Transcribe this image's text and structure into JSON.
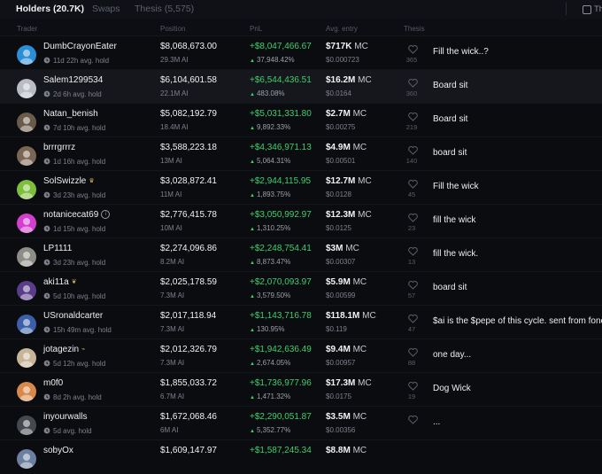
{
  "tabs": [
    {
      "label": "Holders (20.7K)"
    },
    {
      "label": "Swaps"
    },
    {
      "label": "Thesis (5,575)"
    }
  ],
  "filter_label": "Th",
  "columns": {
    "trader": "Trader",
    "position": "Position",
    "pnl": "PnL",
    "entry": "Avg. entry",
    "thesis": "Thesis"
  },
  "rows": [
    {
      "name": "DumbCrayonEater",
      "badge": "",
      "hold": "11d 22h avg. hold",
      "position": "$8,068,673.00",
      "amount": "29.3M AI",
      "pnl": "+$8,047,466.67",
      "pct": "37,948.42%",
      "mc": "$717K",
      "mc_unit": "MC",
      "entry": "$0.000723",
      "likes": "365",
      "thesis": "Fill the wick..?",
      "avatar_color": "#2c8ed6",
      "avatar_icon": "glasses-avatar"
    },
    {
      "name": "Salem1299534",
      "badge": "",
      "hold": "2d 6h avg. hold",
      "position": "$6,104,601.58",
      "amount": "22.1M AI",
      "pnl": "+$6,544,436.51",
      "pct": "483.08%",
      "mc": "$16.2M",
      "mc_unit": "MC",
      "entry": "$0.0164",
      "likes": "360",
      "thesis": "Board sit",
      "avatar_color": "#b9bcc4",
      "avatar_icon": "default-user-avatar"
    },
    {
      "name": "Natan_benish",
      "badge": "",
      "hold": "7d 10h avg. hold",
      "position": "$5,082,192.79",
      "amount": "18.4M AI",
      "pnl": "+$5,031,331.80",
      "pct": "9,892.33%",
      "mc": "$2.7M",
      "mc_unit": "MC",
      "entry": "$0.00275",
      "likes": "219",
      "thesis": "Board sit",
      "avatar_color": "#6a5a4a",
      "avatar_icon": "photo-avatar"
    },
    {
      "name": "brrrgrrrz",
      "badge": "",
      "hold": "1d 16h avg. hold",
      "position": "$3,588,223.18",
      "amount": "13M AI",
      "pnl": "+$4,346,971.13",
      "pct": "5,064.31%",
      "mc": "$4.9M",
      "mc_unit": "MC",
      "entry": "$0.00501",
      "likes": "140",
      "thesis": "board sit",
      "avatar_color": "#7a6652",
      "avatar_icon": "photo-avatar"
    },
    {
      "name": "SolSwizzle",
      "badge": "crown",
      "hold": "3d 23h avg. hold",
      "position": "$3,028,872.41",
      "amount": "11M AI",
      "pnl": "+$2,944,115.95",
      "pct": "1,893.75%",
      "mc": "$12.7M",
      "mc_unit": "MC",
      "entry": "$0.0128",
      "likes": "45",
      "thesis": "Fill the wick",
      "avatar_color": "#7dbf3a",
      "avatar_icon": "cartoon-avatar"
    },
    {
      "name": "notanicecat69",
      "badge": "info",
      "hold": "1d 15h avg. hold",
      "position": "$2,776,415.78",
      "amount": "10M AI",
      "pnl": "+$3,050,992.97",
      "pct": "1,310.25%",
      "mc": "$12.3M",
      "mc_unit": "MC",
      "entry": "$0.0125",
      "likes": "23",
      "thesis": "fill the wick",
      "avatar_color": "#d23fcf",
      "avatar_icon": "cat-avatar"
    },
    {
      "name": "LP1111",
      "badge": "",
      "hold": "3d 23h avg. hold",
      "position": "$2,274,096.86",
      "amount": "8.2M AI",
      "pnl": "+$2,248,754.41",
      "pct": "8,873.47%",
      "mc": "$3M",
      "mc_unit": "MC",
      "entry": "$0.00307",
      "likes": "13",
      "thesis": "fill the wick.",
      "avatar_color": "#8d8c86",
      "avatar_icon": "photo-avatar"
    },
    {
      "name": "aki11a",
      "badge": "leaf",
      "hold": "5d 10h avg. hold",
      "position": "$2,025,178.59",
      "amount": "7.3M AI",
      "pnl": "+$2,070,093.97",
      "pct": "3,579.50%",
      "mc": "$5.9M",
      "mc_unit": "MC",
      "entry": "$0.00599",
      "likes": "57",
      "thesis": "board sit",
      "avatar_color": "#5a3d8a",
      "avatar_icon": "anime-avatar"
    },
    {
      "name": "USronaldcarter",
      "badge": "",
      "hold": "15h 49m avg. hold",
      "position": "$2,017,118.94",
      "amount": "7.3M AI",
      "pnl": "+$1,143,716.78",
      "pct": "130.95%",
      "mc": "$118.1M",
      "mc_unit": "MC",
      "entry": "$0.119",
      "likes": "47",
      "thesis": "$ai is the $pepe of this cycle. sent from fone",
      "avatar_color": "#3b5fa8",
      "avatar_icon": "flag-avatar"
    },
    {
      "name": "jotagezin",
      "badge": "link",
      "hold": "5d 12h avg. hold",
      "position": "$2,012,326.79",
      "amount": "7.3M AI",
      "pnl": "+$1,942,636.49",
      "pct": "2,674.05%",
      "mc": "$9.4M",
      "mc_unit": "MC",
      "entry": "$0.00957",
      "likes": "88",
      "thesis": "one day...",
      "avatar_color": "#c7b59a",
      "avatar_icon": "photo-avatar"
    },
    {
      "name": "m0f0",
      "badge": "",
      "hold": "8d 2h avg. hold",
      "position": "$1,855,033.72",
      "amount": "6.7M AI",
      "pnl": "+$1,736,977.96",
      "pct": "1,471.32%",
      "mc": "$17.3M",
      "mc_unit": "MC",
      "entry": "$0.0175",
      "likes": "19",
      "thesis": "Dog Wick",
      "avatar_color": "#d8894a",
      "avatar_icon": "dog-avatar"
    },
    {
      "name": "inyourwalls",
      "badge": "",
      "hold": "5d avg. hold",
      "position": "$1,672,068.46",
      "amount": "6M AI",
      "pnl": "+$2,290,051.87",
      "pct": "5,352.77%",
      "mc": "$3.5M",
      "mc_unit": "MC",
      "entry": "$0.00356",
      "likes": "",
      "thesis": "...",
      "avatar_color": "#44484f",
      "avatar_icon": "photo-avatar"
    },
    {
      "name": "sobyOx",
      "badge": "",
      "hold": "",
      "position": "$1,609,147.97",
      "amount": "",
      "pnl": "+$1,587,245.34",
      "pct": "",
      "mc": "$8.8M",
      "mc_unit": "MC",
      "entry": "",
      "likes": "",
      "thesis": "",
      "avatar_color": "#6b7fa0",
      "avatar_icon": "photo-avatar"
    }
  ]
}
